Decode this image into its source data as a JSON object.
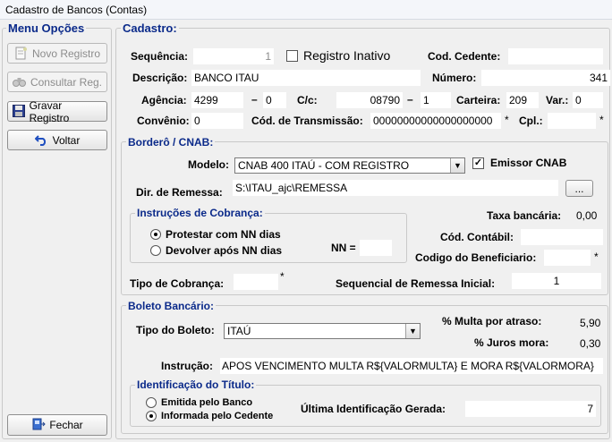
{
  "window": {
    "title": "Cadastro de Bancos (Contas)"
  },
  "menu": {
    "legend": "Menu Opções",
    "novo": "Novo Registro",
    "consultar": "Consultar Reg.",
    "gravar": "Gravar Registro",
    "voltar": "Voltar",
    "fechar": "Fechar"
  },
  "cadastro": {
    "legend": "Cadastro:",
    "sequencia_label": "Sequência:",
    "sequencia": "1",
    "inativo_label": "Registro Inativo",
    "inativo_checked": false,
    "cod_cedente_label": "Cod. Cedente:",
    "cod_cedente": "",
    "descricao_label": "Descrição:",
    "descricao": "BANCO ITAU",
    "numero_label": "Número:",
    "numero": "341",
    "agencia_label": "Agência:",
    "agencia": "4299",
    "agencia_dv": "0",
    "cc_label": "C/c:",
    "cc": "08790",
    "cc_dv": "1",
    "carteira_label": "Carteira:",
    "carteira": "209",
    "var_label": "Var.:",
    "var": "0",
    "convenio_label": "Convênio:",
    "convenio": "0",
    "cod_transmissao_label": "Cód. de Transmissão:",
    "cod_transmissao": "00000000000000000000",
    "cpl_label": "Cpl.:",
    "cpl": "",
    "dash": "–",
    "star": "*"
  },
  "bordero": {
    "legend": "Borderô / CNAB:",
    "modelo_label": "Modelo:",
    "modelo": "CNAB 400 ITAÚ - COM REGISTRO",
    "emissor_label": "Emissor CNAB",
    "emissor_checked": true,
    "dir_label": "Dir. de Remessa:",
    "dir": "S:\\ITAU_ajc\\REMESSA",
    "browse_label": "...",
    "instrucoes_legend": "Instruções de Cobrança:",
    "protestar_label": "Protestar com NN dias",
    "devolver_label": "Devolver após NN dias",
    "nn_label": "NN =",
    "nn": "",
    "taxa_label": "Taxa bancária:",
    "taxa": "0,00",
    "cod_contabil_label": "Cód. Contábil:",
    "cod_contabil": "",
    "cod_beneficiario_label": "Codigo do Beneficiario:",
    "cod_beneficiario": "",
    "tipo_cobranca_label": "Tipo de Cobrança:",
    "tipo_cobranca": "",
    "seq_remessa_label": "Sequencial de Remessa Inicial:",
    "seq_remessa": "1"
  },
  "boleto": {
    "legend": "Boleto Bancário:",
    "tipo_label": "Tipo do Boleto:",
    "tipo": "ITAÚ",
    "multa_label": "% Multa por atraso:",
    "multa": "5,90",
    "juros_label": "% Juros mora:",
    "juros": "0,30",
    "instrucao_label": "Instrução:",
    "instrucao": "APOS VENCIMENTO MULTA R${VALORMULTA} E MORA R${VALORMORA}",
    "ident_legend": "Identificação do Título:",
    "emitida_label": "Emitida pelo Banco",
    "informada_label": "Informada pelo Cedente",
    "ultima_label": "Última Identificação Gerada:",
    "ultima": "7"
  }
}
